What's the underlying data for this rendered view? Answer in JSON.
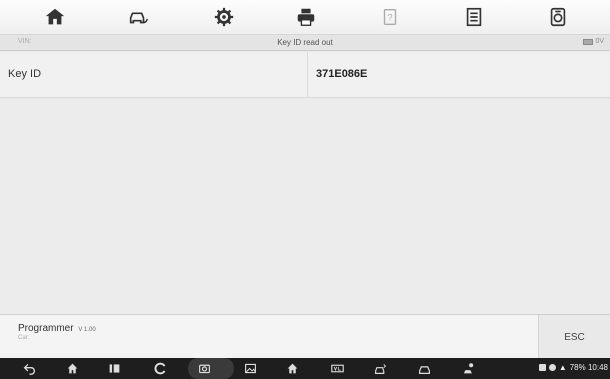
{
  "toolbar": {
    "buttons": [
      {
        "icon": "home-icon"
      },
      {
        "icon": "vehicle-swap-icon"
      },
      {
        "icon": "settings-gear-icon"
      },
      {
        "icon": "print-icon"
      },
      {
        "icon": "help-icon"
      },
      {
        "icon": "save-icon"
      },
      {
        "icon": "data-logging-icon"
      }
    ]
  },
  "titlebar": {
    "vin": "VIN:",
    "title": "Key ID read out",
    "voltage": "0V"
  },
  "result": {
    "label": "Key ID",
    "value": "371E086E"
  },
  "footer": {
    "app_name": "Programmer",
    "version": "V 1.00",
    "car": "Car:",
    "esc_label": "ESC"
  },
  "statusbar": {
    "text": "78%  10:48"
  },
  "colors": {
    "toolbar_bg": "#f7f7f7",
    "content_bg": "#ececec",
    "navbar_bg": "#1e1e1e"
  }
}
